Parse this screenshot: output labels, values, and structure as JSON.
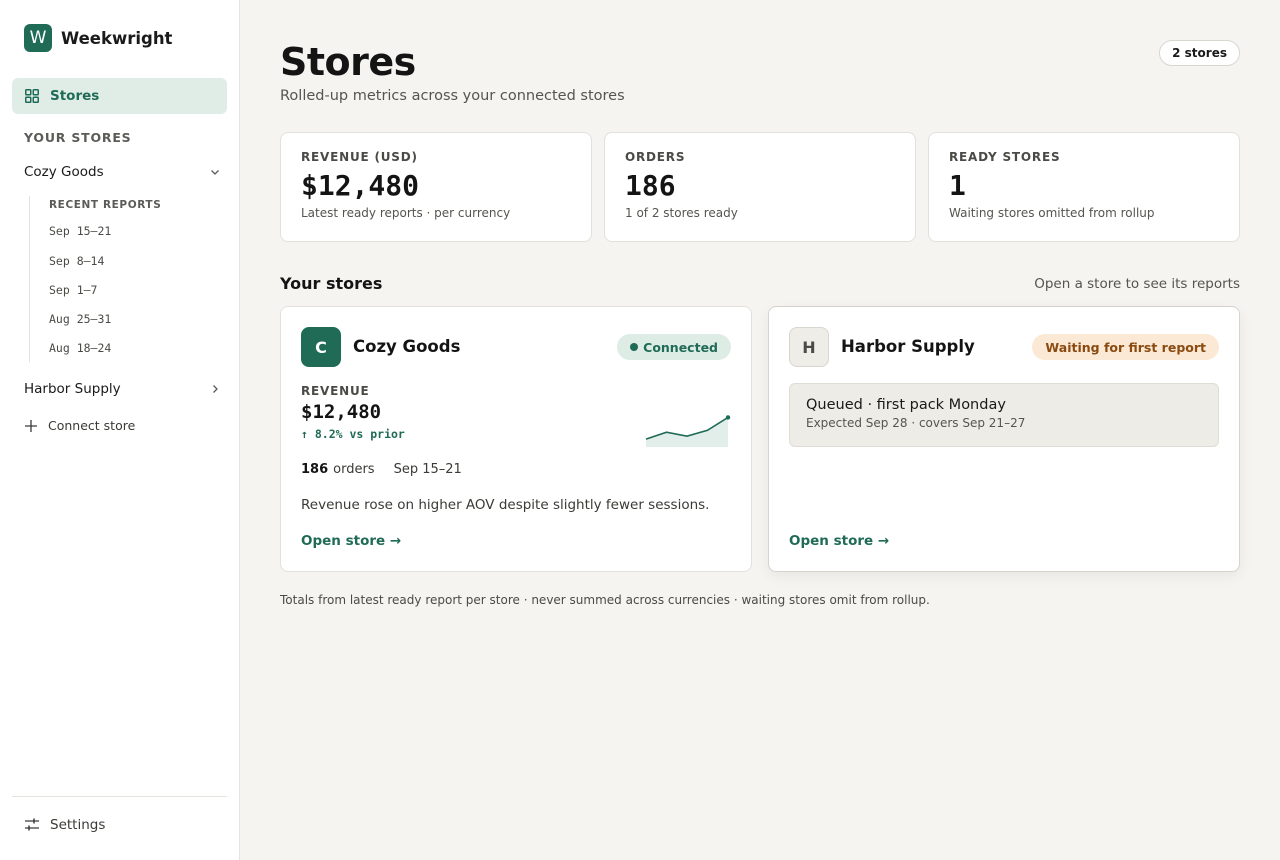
{
  "app": {
    "name": "Weekwright",
    "logo_letter": "W",
    "accent": "#1f6b56"
  },
  "nav": {
    "stores_label": "Stores",
    "your_stores_heading": "YOUR STORES",
    "connect_label": "Connect store",
    "settings_label": "Settings"
  },
  "sidebar_stores": [
    {
      "name": "Cozy Goods",
      "expanded": true,
      "reports_heading": "RECENT REPORTS",
      "reports": [
        "Sep 15–21",
        "Sep 8–14",
        "Sep 1–7",
        "Aug 25–31",
        "Aug 18–24"
      ]
    },
    {
      "name": "Harbor Supply",
      "expanded": false
    }
  ],
  "header": {
    "title": "Stores",
    "subtitle": "Rolled-up metrics across your connected stores",
    "count_badge": "2 stores"
  },
  "metrics": [
    {
      "label": "REVENUE (USD)",
      "value": "$12,480",
      "note": "Latest ready reports · per currency"
    },
    {
      "label": "ORDERS",
      "value": "186",
      "note": "1 of 2 stores ready"
    },
    {
      "label": "READY STORES",
      "value": "1",
      "note": "Waiting stores omitted from rollup"
    }
  ],
  "stores_section": {
    "title": "Your stores",
    "hint": "Open a store to see its reports"
  },
  "cards": {
    "cozy": {
      "initial": "C",
      "name": "Cozy Goods",
      "status": "Connected",
      "revenue_label": "REVENUE",
      "revenue": "$12,480",
      "change": "↑ 8.2% vs prior",
      "sparkline": [
        10.2,
        11.6,
        10.8,
        12.0,
        14.6
      ],
      "orders_count": "186",
      "orders_word": "orders",
      "range": "Sep  15–21",
      "summary": "Revenue rose on higher AOV despite slightly fewer sessions.",
      "open_label": "Open store →"
    },
    "harbor": {
      "initial": "H",
      "name": "Harbor Supply",
      "status": "Waiting for first report",
      "queue_title": "Queued · first pack Monday",
      "queue_note": "Expected Sep 28 · covers Sep 21–27",
      "open_label": "Open store →"
    }
  },
  "footnote": "Totals from latest ready report per store · never summed across currencies · waiting stores omit from rollup."
}
